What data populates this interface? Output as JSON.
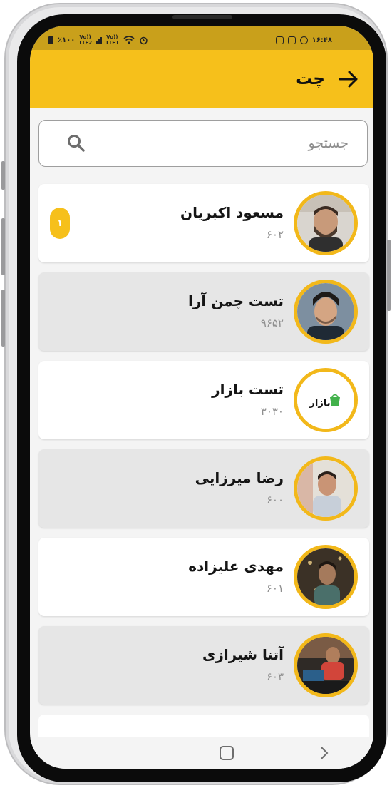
{
  "status_bar": {
    "time": "۱۶:۴۸",
    "battery": "٪۱۰۰",
    "network_1": "LTE2",
    "network_2": "LTE1",
    "volte_1": "Vo))",
    "volte_2": "Vo))",
    "icons": [
      "instagram-icon",
      "instagram-icon",
      "whatsapp-icon",
      "wifi-icon",
      "alarm-icon",
      "battery-icon"
    ]
  },
  "header": {
    "title": "چت",
    "back_icon": "arrow-right-icon",
    "color": "#f6c01b"
  },
  "search": {
    "placeholder": "جستجو",
    "icon": "search-icon"
  },
  "chats": [
    {
      "name": "مسعود اکبریان",
      "id": "۶۰۲",
      "unread": "۱",
      "background": "white",
      "avatar": "man-beard"
    },
    {
      "name": "تست چمن آرا",
      "id": "۹۶۵۲",
      "unread": "",
      "background": "gray",
      "avatar": "man-dark-hair"
    },
    {
      "name": "تست بازار",
      "id": "۳۰۳۰",
      "unread": "",
      "background": "white",
      "avatar": "bazaar-logo"
    },
    {
      "name": "رضا میرزایی",
      "id": "۶۰۰",
      "unread": "",
      "background": "gray",
      "avatar": "man-office"
    },
    {
      "name": "مهدی علیزاده",
      "id": "۶۰۱",
      "unread": "",
      "background": "white",
      "avatar": "man-night"
    },
    {
      "name": "آتنا شیرازی",
      "id": "۶۰۳",
      "unread": "",
      "background": "gray",
      "avatar": "desk-photo"
    }
  ],
  "bazaar_logo_text": "بازار",
  "colors": {
    "accent": "#f6c01b",
    "avatar_ring": "#f2b81a",
    "status_bar": "#c9a01b"
  }
}
